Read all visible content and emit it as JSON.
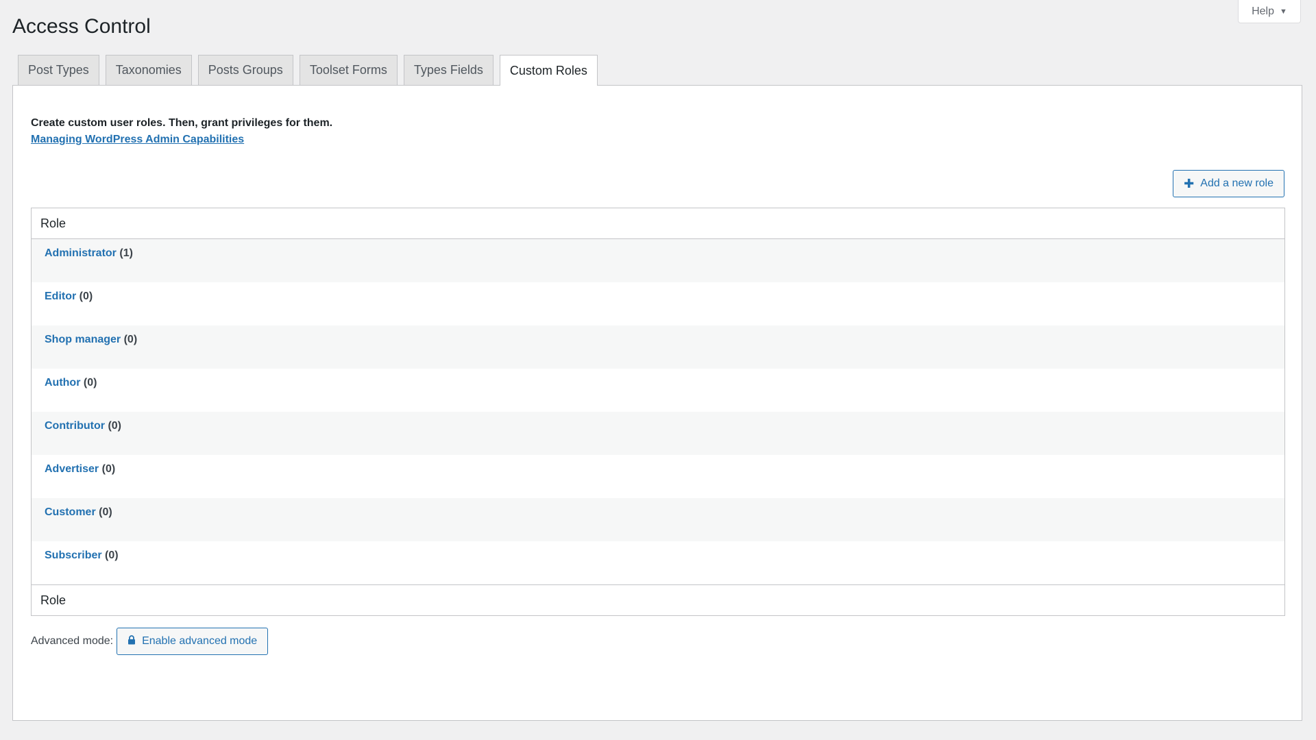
{
  "page": {
    "title": "Access Control",
    "help_label": "Help",
    "help_caret": "▼"
  },
  "tabs": [
    {
      "label": "Post Types"
    },
    {
      "label": "Taxonomies"
    },
    {
      "label": "Posts Groups"
    },
    {
      "label": "Toolset Forms"
    },
    {
      "label": "Types Fields"
    },
    {
      "label": "Custom Roles",
      "active": true
    }
  ],
  "panel": {
    "intro": "Create custom user roles. Then, grant privileges for them.",
    "doc_link": "Managing WordPress Admin Capabilities",
    "add_role": {
      "icon": "plus-icon",
      "label": "Add a new role"
    }
  },
  "table": {
    "header": "Role",
    "footer": "Role",
    "rows": [
      {
        "name": "Administrator",
        "count": "(1)"
      },
      {
        "name": "Editor",
        "count": "(0)"
      },
      {
        "name": "Shop manager",
        "count": "(0)"
      },
      {
        "name": "Author",
        "count": "(0)"
      },
      {
        "name": "Contributor",
        "count": "(0)"
      },
      {
        "name": "Advertiser",
        "count": "(0)"
      },
      {
        "name": "Customer",
        "count": "(0)"
      },
      {
        "name": "Subscriber",
        "count": "(0)"
      }
    ]
  },
  "advanced": {
    "label": "Advanced mode:",
    "button_icon": "lock-icon",
    "button_label": "Enable advanced mode"
  },
  "colors": {
    "accent": "#2271b1",
    "background": "#f0f0f1"
  }
}
